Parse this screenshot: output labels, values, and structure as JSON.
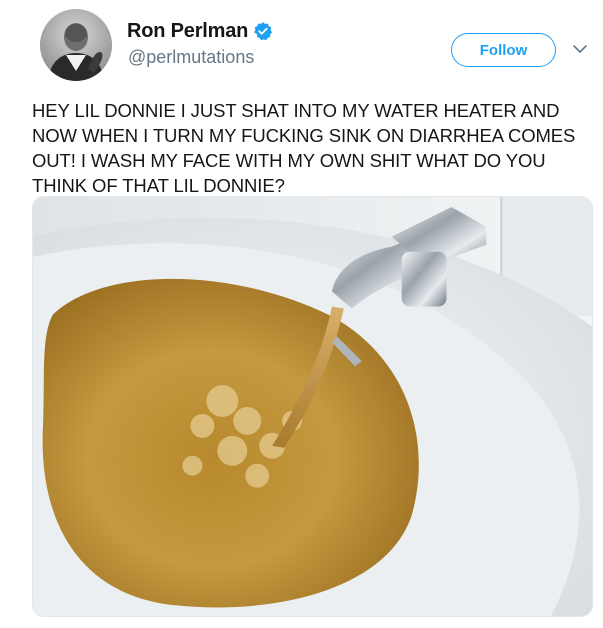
{
  "user": {
    "display_name": "Ron Perlman",
    "handle": "@perlmutations",
    "verified": true,
    "avatar_icon": "user-avatar-photo"
  },
  "actions": {
    "follow_label": "Follow",
    "more_icon": "chevron-down-icon"
  },
  "tweet": {
    "text": "HEY LIL DONNIE I JUST SHAT INTO MY WATER HEATER AND NOW WHEN I TURN MY FUCKING SINK ON DIARRHEA COMES OUT! I WASH MY FACE WITH MY OWN SHIT WHAT DO YOU THINK OF THAT LIL DONNIE?"
  },
  "media": {
    "image_icon": "brown-water-sink-photo"
  },
  "colors": {
    "accent": "#1da1f2",
    "text": "#14171a",
    "secondary_text": "#657786"
  }
}
